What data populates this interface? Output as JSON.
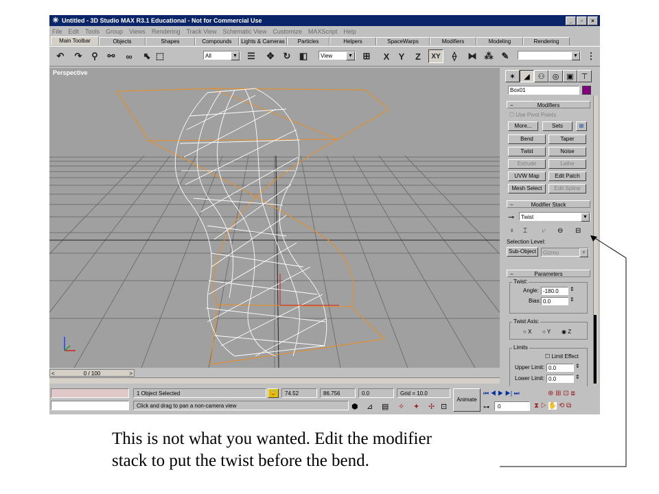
{
  "window": {
    "title": "Untitled - 3D Studio MAX R3.1 Educational - Not for Commercial Use",
    "controls": [
      "_",
      "▫",
      "×"
    ]
  },
  "menu": [
    "File",
    "Edit",
    "Tools",
    "Group",
    "Views",
    "Rendering",
    "Track View",
    "Schematic View",
    "Customize",
    "MAXScript",
    "Help"
  ],
  "tabs": [
    "Main Toolbar",
    "Objects",
    "Shapes",
    "Compounds",
    "Lights & Cameras",
    "Particles",
    "Helpers",
    "SpaceWarps",
    "Modifiers",
    "Modeling",
    "Rendering"
  ],
  "toolbar": {
    "selection_filter": "All",
    "coord_system": "View",
    "axis_x": "X",
    "axis_y": "Y",
    "axis_z": "Z",
    "axis_xy": "XY"
  },
  "viewport": {
    "label": "Perspective"
  },
  "timeline": {
    "frame": "0 / 100"
  },
  "status": {
    "selected": "1 Object Selected",
    "prompt": "Click and drag to pan a non-camera view",
    "x": "74.52",
    "y": "86.756",
    "z": "0.0",
    "grid": "Grid = 10.0",
    "animate": "Animate",
    "frame_field": "0"
  },
  "command_panel": {
    "object_name": "Box01",
    "object_color": "#800080",
    "modifiers": {
      "title": "Modifiers",
      "use_pivot": "Use Pivot Points",
      "more": "More...",
      "sets": "Sets",
      "buttons": [
        "Bend",
        "Taper",
        "Twist",
        "Noise",
        "Extrude",
        "Lathe",
        "UVW Map",
        "Edit Patch",
        "Mesh Select",
        "Edit Spline"
      ]
    },
    "stack": {
      "title": "Modifier Stack",
      "current": "Twist",
      "selection_level": "Selection Level:",
      "sub_object": "Sub-Object",
      "gizmo": "Gizmo"
    },
    "parameters": {
      "title": "Parameters",
      "twist": "Twist:",
      "angle_label": "Angle:",
      "angle": "-180.0",
      "bias_label": "Bias:",
      "bias": "0.0",
      "twist_axis": "Twist Axis:",
      "axis_x": "X",
      "axis_y": "Y",
      "axis_z": "Z",
      "limits": "Limits",
      "limit_effect": "Limit Effect",
      "upper_label": "Upper Limit:",
      "upper": "0.0",
      "lower_label": "Lower Limit:",
      "lower": "0.0"
    }
  },
  "caption": {
    "line1": "This is not what you wanted. Edit the modifier",
    "line2": "stack to put the twist before the bend."
  },
  "colors": {
    "title_bar": "#0a246a",
    "ui_bg": "#c0c0c0",
    "viewport": "#a0a0a0",
    "grid": "#6f6f6f",
    "bbox": "#e09030",
    "mesh": "#ffffff"
  }
}
